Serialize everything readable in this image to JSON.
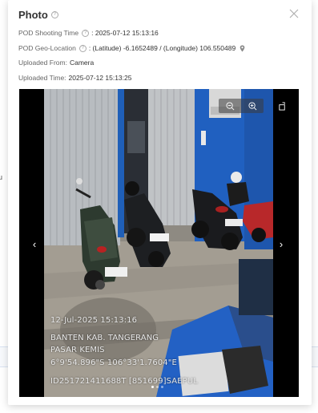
{
  "background": {
    "fragment_left": "u"
  },
  "modal": {
    "title": "Photo",
    "close_icon": "close-icon",
    "help_icon": "question-circle-icon",
    "rows": {
      "shooting_time_label": "POD Shooting Time",
      "shooting_time_value": ": 2025-07-12 15:13:16",
      "geo_label": "POD Geo-Location",
      "geo_value": ": (Latitude) -6.1652489 / (Longitude) 106.550489",
      "uploaded_from_label": "Uploaded From:",
      "uploaded_from_value": "Camera",
      "uploaded_time_label": "Uploaded Time:",
      "uploaded_time_value": "2025-07-12 15:13:25"
    }
  },
  "viewer": {
    "zoom_out_icon": "zoom-out-icon",
    "zoom_in_icon": "zoom-in-icon",
    "rotate_icon": "rotate-icon",
    "prev_icon": "chevron-left-icon",
    "next_icon": "chevron-right-icon",
    "prev_glyph": "‹",
    "next_glyph": "›",
    "watermark": {
      "line1": "12-Jul-2025 15:13:16",
      "line2": "BANTEN KAB. TANGERANG",
      "line3": "PASAR KEMIS",
      "line4": "6°9'54.896\"S 106°33'1.7604\"E",
      "line5": "ID251721411688T    [851699]SAEPUL"
    }
  },
  "colors": {
    "accent_blue": "#1f5fb8",
    "wall_blue": "#2060c0"
  }
}
